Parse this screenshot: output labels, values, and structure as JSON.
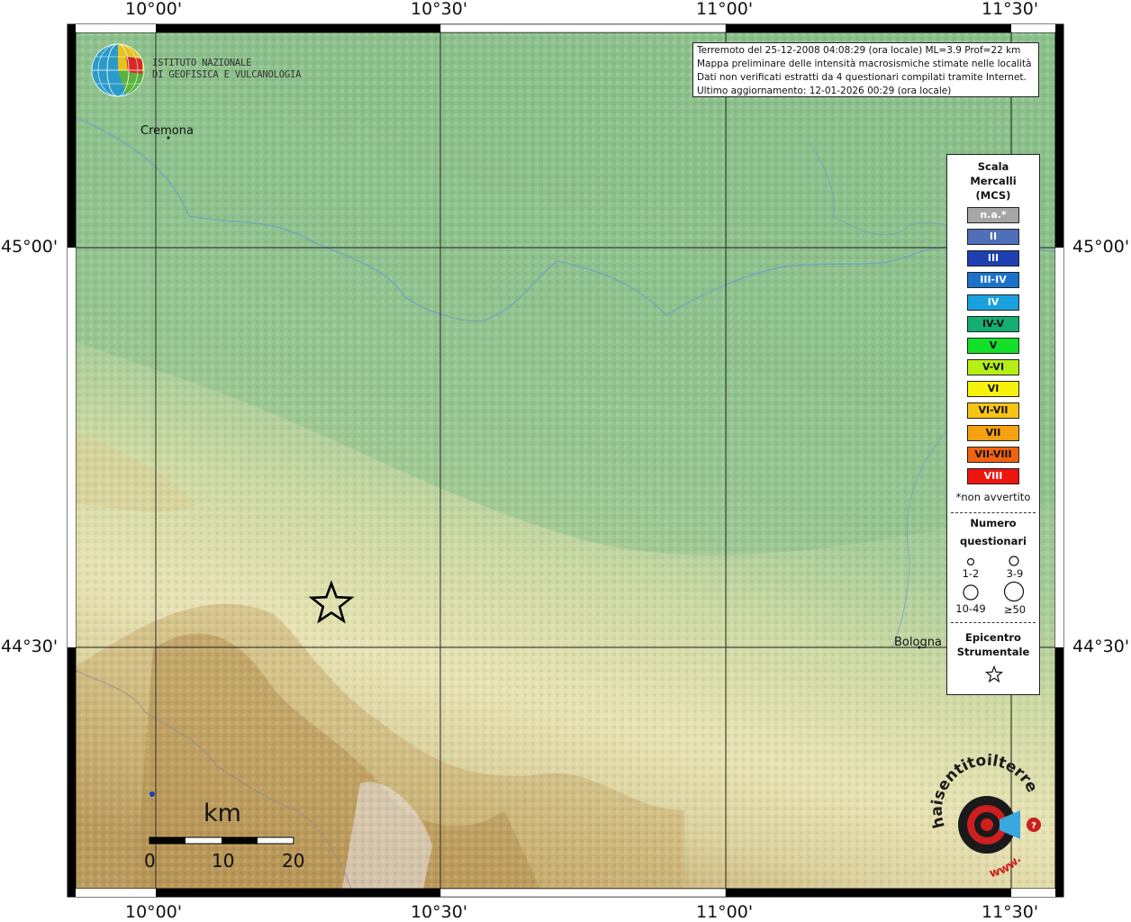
{
  "info": {
    "line1": "Terremoto del 25-12-2008 04:08:29 (ora locale) ML=3.9 Prof=22 km",
    "line2": "Mappa preliminare delle intensità macrosismiche stimate nelle località",
    "line3": "Dati non verificati estratti da 4 questionari compilati tramite Internet.",
    "line4": "Ultimo aggiornamento: 12-01-2026 00:29 (ora locale)"
  },
  "logo": {
    "line1": "ISTITUTO NAZIONALE",
    "line2": "DI GEOFISICA E VULCANOLOGIA"
  },
  "axes": {
    "lon_ticks": [
      "10°00'",
      "10°30'",
      "11°00'",
      "11°30'"
    ],
    "lat_ticks": [
      "45°00'",
      "44°30'"
    ]
  },
  "cities": {
    "cremona": "Cremona",
    "bologna": "Bologna"
  },
  "legend": {
    "title1": "Scala",
    "title2": "Mercalli",
    "title3": "(MCS)",
    "classes": [
      {
        "label": "n.a.*",
        "color": "#a6a6a6",
        "text": "#ffffff"
      },
      {
        "label": "II",
        "color": "#4f6fb8",
        "text": "#ffffff"
      },
      {
        "label": "III",
        "color": "#1f3fb0",
        "text": "#ffffff"
      },
      {
        "label": "III-IV",
        "color": "#1a72cc",
        "text": "#ffffff"
      },
      {
        "label": "IV",
        "color": "#19a0df",
        "text": "#ffffff"
      },
      {
        "label": "IV-V",
        "color": "#13b071",
        "text": "#111111"
      },
      {
        "label": "V",
        "color": "#14e02a",
        "text": "#111111"
      },
      {
        "label": "V-VI",
        "color": "#b6ef14",
        "text": "#111111"
      },
      {
        "label": "VI",
        "color": "#f6f20e",
        "text": "#111111"
      },
      {
        "label": "VI-VII",
        "color": "#f6c414",
        "text": "#111111"
      },
      {
        "label": "VII",
        "color": "#f6a112",
        "text": "#111111"
      },
      {
        "label": "VII-VIII",
        "color": "#f26310",
        "text": "#111111"
      },
      {
        "label": "VIII",
        "color": "#ee1410",
        "text": "#ffffff"
      }
    ],
    "not_felt": "*non avvertito",
    "count_title1": "Numero",
    "count_title2": "questionari",
    "counts": [
      "1-2",
      "3-9",
      "10-49",
      "≥50"
    ],
    "epi_title1": "Epicentro",
    "epi_title2": "Strumentale"
  },
  "scale_bar": {
    "unit": "km",
    "ticks": [
      "0",
      "10",
      "20"
    ]
  },
  "brand": {
    "text": "haisentitoilterremoto.it",
    "www": "www."
  }
}
